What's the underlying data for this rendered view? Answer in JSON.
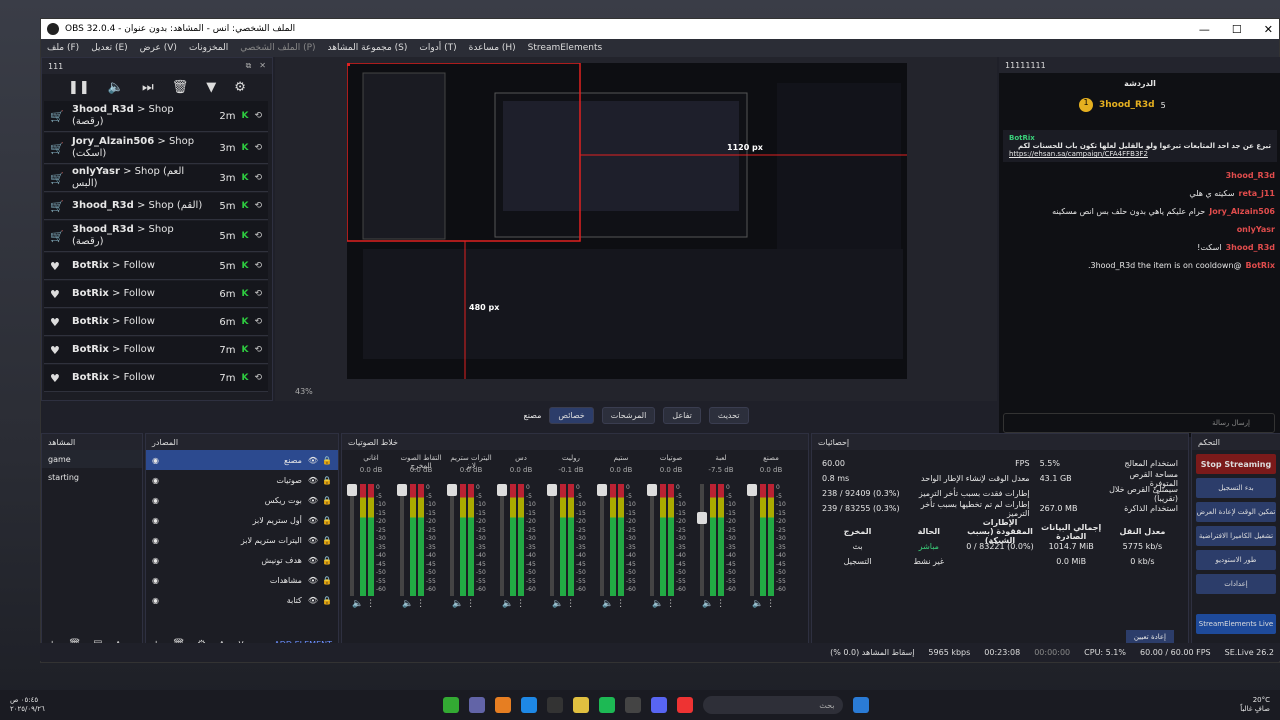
{
  "window": {
    "title": "OBS 32.0.4 - الملف الشخصي: انس - المشاهد: بدون عنوان"
  },
  "menu": [
    "ملف (F)",
    "تعديل (E)",
    "عرض (V)",
    "المخزونات",
    "الملف الشخصي (P)",
    "مجموعة المشاهد (S)",
    "أدوات (T)",
    "مساعدة (H)",
    "StreamElements"
  ],
  "events": {
    "title": "111",
    "items": [
      {
        "icon": "cart-icon",
        "name": "3hood_R3d",
        "action": "> Shop",
        "extra": "(رقصة)",
        "time": "2m"
      },
      {
        "icon": "cart-icon",
        "name": "Jory_Alzain506",
        "action": "> Shop",
        "extra": "(اسكت)",
        "time": "3m"
      },
      {
        "icon": "cart-icon",
        "name": "onlyYasr",
        "action": "> Shop (العم البس)",
        "extra": "",
        "time": "3m"
      },
      {
        "icon": "cart-icon",
        "name": "3hood_R3d",
        "action": "> Shop (القم)",
        "extra": "",
        "time": "5m"
      },
      {
        "icon": "cart-icon",
        "name": "3hood_R3d",
        "action": "> Shop",
        "extra": "(رقصة)",
        "time": "5m"
      },
      {
        "icon": "heart-icon",
        "name": "BotRix",
        "action": "> Follow",
        "extra": "",
        "time": "5m"
      },
      {
        "icon": "heart-icon",
        "name": "BotRix",
        "action": "> Follow",
        "extra": "",
        "time": "6m"
      },
      {
        "icon": "heart-icon",
        "name": "BotRix",
        "action": "> Follow",
        "extra": "",
        "time": "6m"
      },
      {
        "icon": "heart-icon",
        "name": "BotRix",
        "action": "> Follow",
        "extra": "",
        "time": "7m"
      },
      {
        "icon": "heart-icon",
        "name": "BotRix",
        "action": "> Follow",
        "extra": "",
        "time": "7m"
      }
    ]
  },
  "preview": {
    "zoom": "43%",
    "dim1": "1120 px",
    "dim2": "480 px",
    "source": "مصنع"
  },
  "controls": {
    "props": "خصائص",
    "filters": "المرشحات",
    "interact": "تفاعل",
    "refresh": "تحديث"
  },
  "chat": {
    "title": "11111111",
    "header": "الدردشة",
    "top_user": "3hood_R3d",
    "top_count": "5",
    "pin_user": "BotRix",
    "pin_text": "تبرع عن جد احد المتابعات تبرعوا ولو بالقليل لعلها تكون باب للحسنات لكم",
    "pin_link": "https://ehsan.sa/campaign/CFA4FFB3F2",
    "input_placeholder": "إرسال رسالة",
    "messages": [
      {
        "user": "3hood_R3d",
        "text": ""
      },
      {
        "user": "reta_j11",
        "text": "سكيته ي هلي"
      },
      {
        "user": "Jory_Alzain506",
        "text": "حرام عليكم ياهي بدون حلف بس انص مسكينه"
      },
      {
        "user": "onlyYasr",
        "text": ""
      },
      {
        "user": "3hood_R3d",
        "text": "اسكت!"
      },
      {
        "user": "BotRix",
        "text": "@3hood_R3d the item is on cooldown."
      }
    ]
  },
  "scenes": {
    "title": "المشاهد",
    "items": [
      "game",
      "starting"
    ]
  },
  "sources": {
    "title": "المصادر",
    "items": [
      "مصنع",
      "صوتيات",
      "بوت ريكس",
      "أول ستريم لابز",
      "اليترات ستريم لابز",
      "هدف تونيش",
      "مشاهدات",
      "كتابة"
    ],
    "add": "ADD ELEMENT"
  },
  "mixer": {
    "title": "خلاط الصوتيات",
    "channels": [
      {
        "name": "اغاني",
        "db": "0.0 dB"
      },
      {
        "name": "التقاط الصوت المخرج",
        "db": "0.0 dB"
      },
      {
        "name": "اليترات ستريم لابز",
        "db": "0.0 dB"
      },
      {
        "name": "دس",
        "db": "0.0 dB"
      },
      {
        "name": "روليت",
        "db": "-0.1 dB"
      },
      {
        "name": "ستيم",
        "db": "0.0 dB"
      },
      {
        "name": "صوتيات",
        "db": "0.0 dB"
      },
      {
        "name": "لعبة",
        "db": "-7.5 dB"
      },
      {
        "name": "مصنع",
        "db": "0.0 dB"
      }
    ]
  },
  "stats": {
    "title": "إحصائيات",
    "rows": [
      {
        "label": "استخدام المعالج",
        "value": "5.5%",
        "label2": "FPS",
        "value2": "60.00"
      },
      {
        "label": "مساحة القرص المتوفرة",
        "value": "43.1 GB",
        "label2": "معدل الوقت لإنشاء الإطار الواحد",
        "value2": "0.8 ms"
      },
      {
        "label": "سيمتلئ القرص خلال (تقريباً)",
        "value": "",
        "label2": "إطارات فقدت بسبب تأخر الترميز",
        "value2": "238 / 92409 (0.3%)"
      },
      {
        "label": "استخدام الذاكرة",
        "value": "267.0 MB",
        "label2": "إطارات لم تم تخطيها بسبب تأخر الترميز",
        "value2": "239 / 83255 (0.3%)"
      }
    ],
    "table_head": [
      "المخرج",
      "الحالة",
      "الإطارات المفقودة (بسبب الشبكة)",
      "إجمالي البيانات الصادرة",
      "معدل النقل"
    ],
    "table": [
      [
        "بث",
        "مباشر",
        "0 / 83221 (0.0%)",
        "1014.7 MiB",
        "5775 kb/s"
      ],
      [
        "التسجيل",
        "غير نشط",
        "",
        "0.0 MiB",
        "0 kb/s"
      ]
    ],
    "reset": "إعادة تعيين"
  },
  "control": {
    "title": "التحكم",
    "stop": "Stop Streaming",
    "buttons": [
      "بدء التسجيل",
      "تمكين الوقت لإعادة العرض",
      "تشغيل الكاميرا الافتراضية",
      "طور الاستوديو",
      "إعدادات"
    ],
    "se": "StreamElements Live"
  },
  "status": {
    "dropped": "إسقاط المشاهد (0.0 %)",
    "kbps": "5965 kbps",
    "live": "00:23:08",
    "rec": "00:00:00",
    "cpu": "CPU: 5.1%",
    "fps": "60.00 / 60.00 FPS",
    "se": "SE.Live 26.2"
  },
  "taskbar": {
    "search": "بحث",
    "time": "٠٥:٤٥ ص",
    "date": "٢٠٢٥/٠٩/٢٦",
    "weather_temp": "20°C",
    "weather": "صافٍ غالباً"
  }
}
